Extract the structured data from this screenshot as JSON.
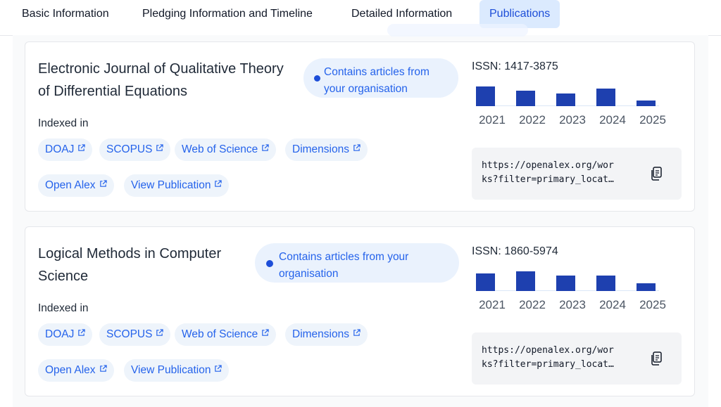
{
  "tabs": [
    {
      "label": "Basic Information"
    },
    {
      "label": "Pledging Information and Timeline"
    },
    {
      "label": "Detailed Information"
    },
    {
      "label": "Publications"
    }
  ],
  "cards": [
    {
      "title_line1": "Electronic Journal of Qualitative Theory",
      "title_line2": "of Differential Equations",
      "badge_line1": "Contains articles from",
      "badge_line2": "your organisation",
      "indexed_label": "Indexed in",
      "chips": [
        "DOAJ",
        "SCOPUS",
        "Web of Science",
        "Dimensions",
        "Open Alex",
        "View Publication"
      ],
      "issn": "ISSN: 1417-3875",
      "years": [
        "2021",
        "2022",
        "2023",
        "2024",
        "2025"
      ],
      "year_levels": [
        1.0,
        0.77,
        0.65,
        0.88,
        0.28
      ],
      "url_line1": "https://openalex.org/wor",
      "url_line2": "ks?filter=primary_locat…"
    },
    {
      "title_line1": "Logical Methods in Computer",
      "title_line2": "Science",
      "badge_line1": "Contains articles from your",
      "badge_line2": "organisation",
      "indexed_label": "Indexed in",
      "chips": [
        "DOAJ",
        "SCOPUS",
        "Web of Science",
        "Dimensions",
        "Open Alex",
        "View Publication"
      ],
      "issn": "ISSN: 1860-5974",
      "years": [
        "2021",
        "2022",
        "2023",
        "2024",
        "2025"
      ],
      "year_levels": [
        0.88,
        1.0,
        0.78,
        0.78,
        0.38
      ],
      "url_line1": "https://openalex.org/wor",
      "url_line2": "ks?filter=primary_locat…"
    }
  ],
  "icons": {
    "external": "external-link-icon",
    "copy": "copy-icon",
    "badge": "check-dot-icon"
  },
  "colors": {
    "accent": "#2563eb",
    "bar": "#1e40af",
    "chip_bg": "#eef4fb",
    "badge_bg": "#eaf2fd"
  }
}
